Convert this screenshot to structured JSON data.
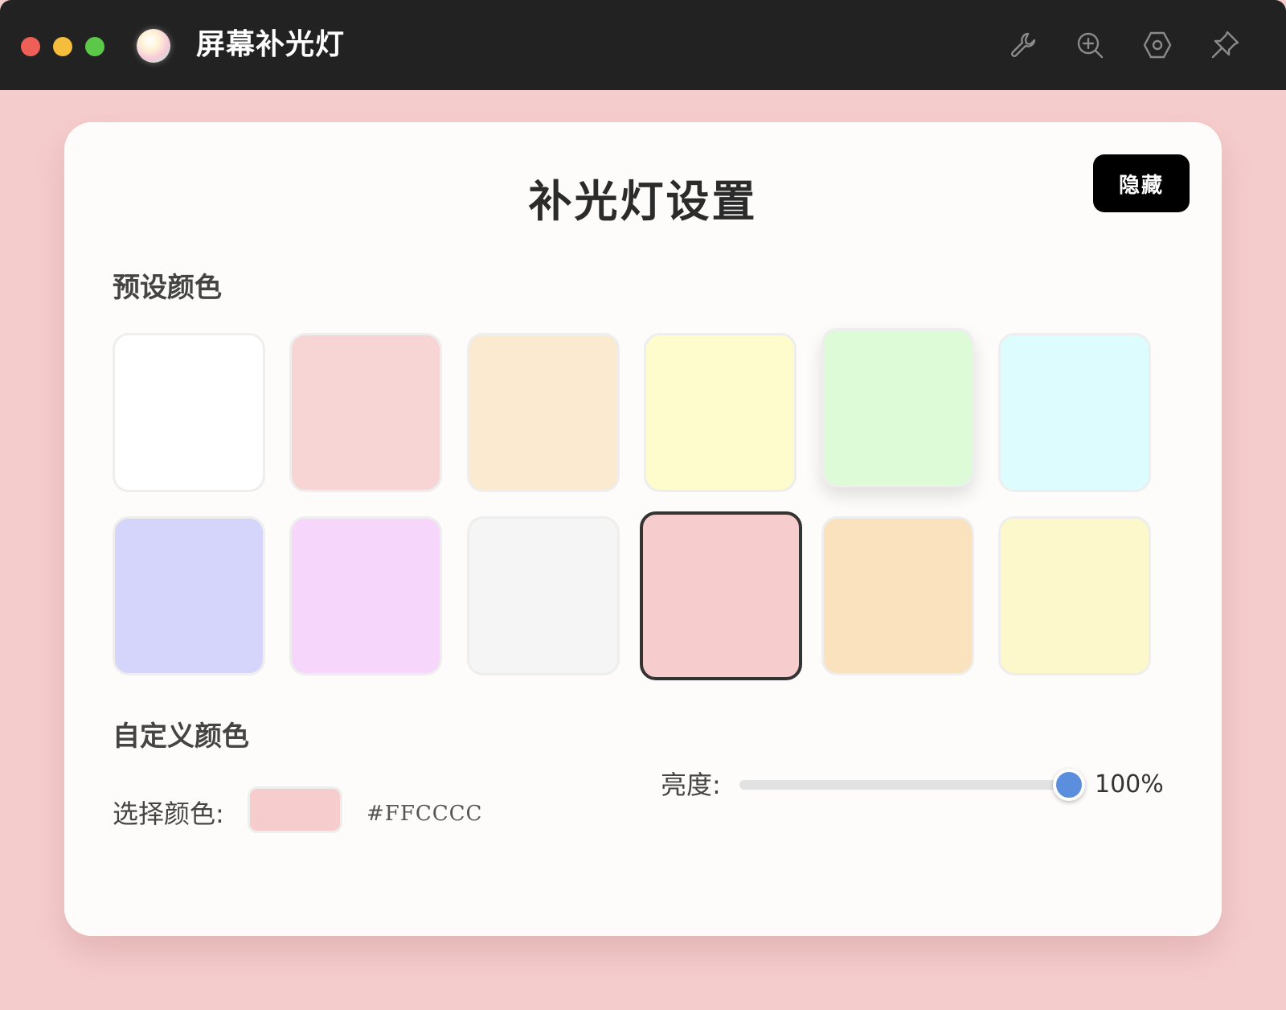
{
  "window": {
    "app_title": "屏幕补光灯",
    "toolbar_icons": [
      "wrench-icon",
      "zoom-in-icon",
      "settings-icon",
      "pin-icon"
    ]
  },
  "panel": {
    "title": "补光灯设置",
    "hide_button": "隐藏",
    "presets_label": "预设颜色",
    "presets": [
      {
        "color": "#ffffff"
      },
      {
        "color": "#f7d5d5"
      },
      {
        "color": "#fbead0"
      },
      {
        "color": "#fefccc"
      },
      {
        "color": "#defbd8"
      },
      {
        "color": "#dcfcfe"
      },
      {
        "color": "#d5d4fa"
      },
      {
        "color": "#f7d6fb"
      },
      {
        "color": "#f5f5f5"
      },
      {
        "color": "#f7cccc",
        "selected": true
      },
      {
        "color": "#f9e2bd"
      },
      {
        "color": "#fdf8cb"
      }
    ],
    "custom_label": "自定义颜色",
    "choose_label": "选择颜色:",
    "custom_color": "#FFCCCC",
    "custom_color_swatch": "#f7cccc",
    "brightness_label": "亮度:",
    "brightness_value": "100%",
    "brightness_level": 1.0
  },
  "colors": {
    "background": "#f5cccc",
    "titlebar": "#222222",
    "accent": "#5b8fde"
  }
}
